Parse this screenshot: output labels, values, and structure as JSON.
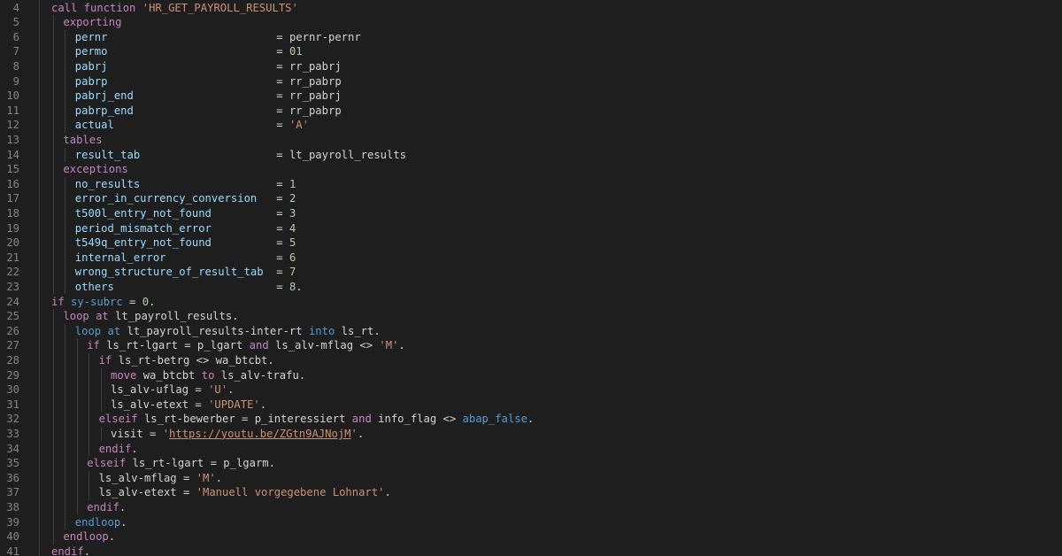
{
  "editor": {
    "lines": [
      {
        "n": "4",
        "indent": 0,
        "tokens": [
          [
            "kw",
            "call function "
          ],
          [
            "str",
            "'HR_GET_PAYROLL_RESULTS'"
          ]
        ]
      },
      {
        "n": "5",
        "indent": 1,
        "tokens": [
          [
            "kw",
            "exporting"
          ]
        ]
      },
      {
        "n": "6",
        "indent": 2,
        "tokens": [
          [
            "var",
            "pernr                          "
          ],
          [
            "op",
            "= "
          ],
          [
            "op",
            "pernr-pernr"
          ]
        ]
      },
      {
        "n": "7",
        "indent": 2,
        "tokens": [
          [
            "var",
            "permo                          "
          ],
          [
            "op",
            "= "
          ],
          [
            "num",
            "01"
          ]
        ]
      },
      {
        "n": "8",
        "indent": 2,
        "tokens": [
          [
            "var",
            "pabrj                          "
          ],
          [
            "op",
            "= "
          ],
          [
            "op",
            "rr_pabrj"
          ]
        ]
      },
      {
        "n": "9",
        "indent": 2,
        "tokens": [
          [
            "var",
            "pabrp                          "
          ],
          [
            "op",
            "= "
          ],
          [
            "op",
            "rr_pabrp"
          ]
        ]
      },
      {
        "n": "10",
        "indent": 2,
        "tokens": [
          [
            "var",
            "pabrj_end                      "
          ],
          [
            "op",
            "= "
          ],
          [
            "op",
            "rr_pabrj"
          ]
        ]
      },
      {
        "n": "11",
        "indent": 2,
        "tokens": [
          [
            "var",
            "pabrp_end                      "
          ],
          [
            "op",
            "= "
          ],
          [
            "op",
            "rr_pabrp"
          ]
        ]
      },
      {
        "n": "12",
        "indent": 2,
        "tokens": [
          [
            "var",
            "actual                         "
          ],
          [
            "op",
            "= "
          ],
          [
            "str",
            "'A'"
          ]
        ]
      },
      {
        "n": "13",
        "indent": 1,
        "tokens": [
          [
            "kw",
            "tables"
          ]
        ]
      },
      {
        "n": "14",
        "indent": 2,
        "tokens": [
          [
            "var",
            "result_tab                     "
          ],
          [
            "op",
            "= "
          ],
          [
            "op",
            "lt_payroll_results"
          ]
        ]
      },
      {
        "n": "15",
        "indent": 1,
        "tokens": [
          [
            "kw",
            "exceptions"
          ]
        ]
      },
      {
        "n": "16",
        "indent": 2,
        "tokens": [
          [
            "var",
            "no_results                     "
          ],
          [
            "op",
            "= "
          ],
          [
            "num",
            "1"
          ]
        ]
      },
      {
        "n": "17",
        "indent": 2,
        "tokens": [
          [
            "var",
            "error_in_currency_conversion   "
          ],
          [
            "op",
            "= "
          ],
          [
            "num",
            "2"
          ]
        ]
      },
      {
        "n": "18",
        "indent": 2,
        "tokens": [
          [
            "var",
            "t500l_entry_not_found          "
          ],
          [
            "op",
            "= "
          ],
          [
            "num",
            "3"
          ]
        ]
      },
      {
        "n": "19",
        "indent": 2,
        "tokens": [
          [
            "var",
            "period_mismatch_error          "
          ],
          [
            "op",
            "= "
          ],
          [
            "num",
            "4"
          ]
        ]
      },
      {
        "n": "20",
        "indent": 2,
        "tokens": [
          [
            "var",
            "t549q_entry_not_found          "
          ],
          [
            "op",
            "= "
          ],
          [
            "num",
            "5"
          ]
        ]
      },
      {
        "n": "21",
        "indent": 2,
        "tokens": [
          [
            "var",
            "internal_error                 "
          ],
          [
            "op",
            "= "
          ],
          [
            "num",
            "6"
          ]
        ]
      },
      {
        "n": "22",
        "indent": 2,
        "tokens": [
          [
            "var",
            "wrong_structure_of_result_tab  "
          ],
          [
            "op",
            "= "
          ],
          [
            "num",
            "7"
          ]
        ]
      },
      {
        "n": "23",
        "indent": 2,
        "tokens": [
          [
            "var",
            "others                         "
          ],
          [
            "op",
            "= "
          ],
          [
            "num",
            "8"
          ],
          [
            "op",
            "."
          ]
        ]
      },
      {
        "n": "24",
        "indent": 0,
        "tokens": [
          [
            "kw",
            "if "
          ],
          [
            "kw2",
            "sy-subrc"
          ],
          [
            "op",
            " = "
          ],
          [
            "num",
            "0"
          ],
          [
            "op",
            "."
          ]
        ]
      },
      {
        "n": "25",
        "indent": 1,
        "tokens": [
          [
            "kw",
            "loop at "
          ],
          [
            "op",
            "lt_payroll_results."
          ]
        ]
      },
      {
        "n": "26",
        "indent": 2,
        "tokens": [
          [
            "kw2",
            "loop at "
          ],
          [
            "op",
            "lt_payroll_results-inter-rt "
          ],
          [
            "kw2",
            "into "
          ],
          [
            "op",
            "ls_rt."
          ]
        ]
      },
      {
        "n": "27",
        "indent": 3,
        "tokens": [
          [
            "kw",
            "if "
          ],
          [
            "op",
            "ls_rt-lgart = p_lgart "
          ],
          [
            "kw",
            "and "
          ],
          [
            "op",
            "ls_alv-mflag <> "
          ],
          [
            "str",
            "'M'"
          ],
          [
            "op",
            "."
          ]
        ]
      },
      {
        "n": "28",
        "indent": 4,
        "tokens": [
          [
            "kw",
            "if "
          ],
          [
            "op",
            "ls_rt-betrg <> wa_btcbt."
          ]
        ]
      },
      {
        "n": "29",
        "indent": 5,
        "tokens": [
          [
            "kw",
            "move "
          ],
          [
            "op",
            "wa_btcbt "
          ],
          [
            "kw",
            "to "
          ],
          [
            "op",
            "ls_alv-trafu."
          ]
        ]
      },
      {
        "n": "30",
        "indent": 5,
        "tokens": [
          [
            "op",
            "ls_alv-uflag = "
          ],
          [
            "str",
            "'U'"
          ],
          [
            "op",
            "."
          ]
        ]
      },
      {
        "n": "31",
        "indent": 5,
        "tokens": [
          [
            "op",
            "ls_alv-etext = "
          ],
          [
            "str",
            "'UPDATE'"
          ],
          [
            "op",
            "."
          ]
        ]
      },
      {
        "n": "32",
        "indent": 4,
        "tokens": [
          [
            "kw",
            "elseif "
          ],
          [
            "op",
            "ls_rt-bewerber = p_interessiert "
          ],
          [
            "kw",
            "and "
          ],
          [
            "op",
            "info_flag <> "
          ],
          [
            "kw2",
            "abap_false"
          ],
          [
            "op",
            "."
          ]
        ]
      },
      {
        "n": "33",
        "indent": 5,
        "tokens": [
          [
            "op",
            "visit = "
          ],
          [
            "str",
            "'"
          ],
          [
            "lnk",
            "https://youtu.be/ZGtn9AJNojM"
          ],
          [
            "str",
            "'"
          ],
          [
            "op",
            "."
          ]
        ]
      },
      {
        "n": "34",
        "indent": 4,
        "tokens": [
          [
            "kw",
            "endif"
          ],
          [
            "op",
            "."
          ]
        ]
      },
      {
        "n": "35",
        "indent": 3,
        "tokens": [
          [
            "kw",
            "elseif "
          ],
          [
            "op",
            "ls_rt-lgart = p_lgarm."
          ]
        ]
      },
      {
        "n": "36",
        "indent": 4,
        "tokens": [
          [
            "op",
            "ls_alv-mflag = "
          ],
          [
            "str",
            "'M'"
          ],
          [
            "op",
            "."
          ]
        ]
      },
      {
        "n": "37",
        "indent": 4,
        "tokens": [
          [
            "op",
            "ls_alv-etext = "
          ],
          [
            "str",
            "'Manuell vorgegebene Lohnart'"
          ],
          [
            "op",
            "."
          ]
        ]
      },
      {
        "n": "38",
        "indent": 3,
        "tokens": [
          [
            "kw",
            "endif"
          ],
          [
            "op",
            "."
          ]
        ]
      },
      {
        "n": "39",
        "indent": 2,
        "tokens": [
          [
            "kw2",
            "endloop"
          ],
          [
            "op",
            "."
          ]
        ]
      },
      {
        "n": "40",
        "indent": 1,
        "tokens": [
          [
            "kw",
            "endloop"
          ],
          [
            "op",
            "."
          ]
        ]
      },
      {
        "n": "41",
        "indent": 0,
        "tokens": [
          [
            "kw",
            "endif"
          ],
          [
            "op",
            "."
          ]
        ]
      }
    ]
  },
  "colors": {
    "background": "#1e1e1e",
    "keyword": "#c586c0",
    "keyword_blue": "#569cd6",
    "string": "#ce9178",
    "number": "#b5cea8",
    "variable": "#9cdcfe",
    "line_number": "#858585"
  }
}
